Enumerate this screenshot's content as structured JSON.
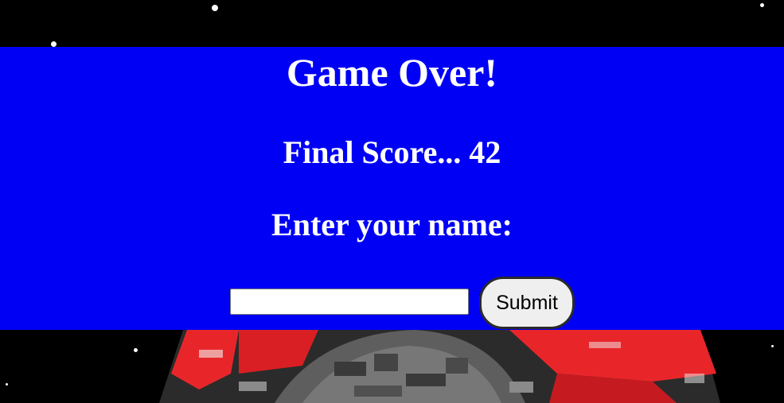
{
  "game_over": {
    "title": "Game Over!",
    "score_line": "Final Score... 42",
    "name_prompt": "Enter your name:",
    "name_input_value": "",
    "submit_label": "Submit"
  },
  "colors": {
    "panel_background": "#0000f5",
    "space_background": "#000000",
    "ship_red": "#e8262a",
    "ship_gray": "#6a6a6a"
  }
}
